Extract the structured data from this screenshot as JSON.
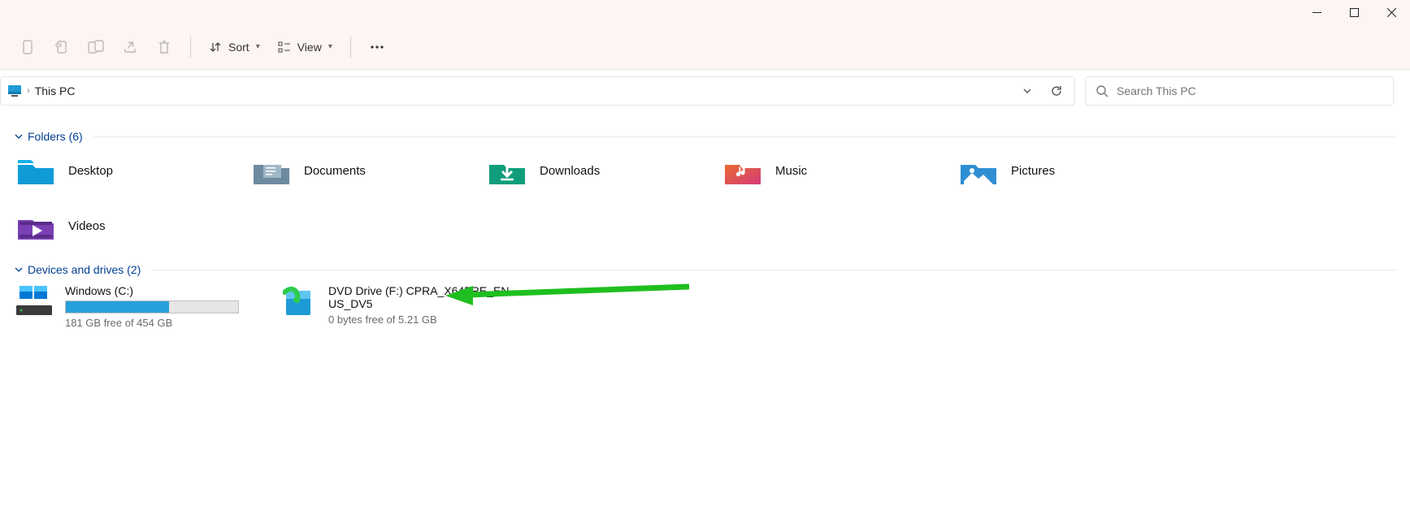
{
  "window": {
    "location": "This PC",
    "search_placeholder": "Search This PC"
  },
  "toolbar": {
    "sort_label": "Sort",
    "view_label": "View"
  },
  "groups": {
    "folders": {
      "header": "Folders (6)"
    },
    "drives": {
      "header": "Devices and drives (2)"
    }
  },
  "folders": [
    {
      "label": "Desktop"
    },
    {
      "label": "Documents"
    },
    {
      "label": "Downloads"
    },
    {
      "label": "Music"
    },
    {
      "label": "Pictures"
    },
    {
      "label": "Videos"
    }
  ],
  "drives": [
    {
      "name": "Windows (C:)",
      "free_text": "181 GB free of 454 GB",
      "fill_pct": 60
    },
    {
      "name": "DVD Drive (F:) CPRA_X64FRE_EN-US_DV5",
      "free_text": "0 bytes free of 5.21 GB"
    }
  ]
}
